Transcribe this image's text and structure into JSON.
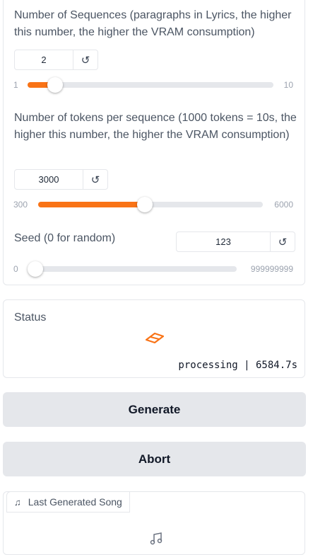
{
  "sequences": {
    "label": "Number of Sequences (paragraphs in Lyrics, the higher this number, the higher the VRAM consumption)",
    "value": "2",
    "min": "1",
    "max": "10",
    "level": 0.111,
    "reset_icon": "reset-icon"
  },
  "tokens": {
    "label": "Number of tokens per sequence (1000 tokens = 10s, the higher this number, the higher the VRAM consumption)",
    "value": "3000",
    "min": "300",
    "max": "6000",
    "level": 0.474,
    "reset_icon": "reset-icon"
  },
  "seed": {
    "label": "Seed (0 for random)",
    "value": "123",
    "min": "0",
    "max": "999999999",
    "level": 0.0,
    "reset_icon": "reset-icon"
  },
  "status": {
    "label": "Status",
    "text": "processing | 6584.7s",
    "icon": "loading-icon",
    "accent": "#f97316"
  },
  "buttons": {
    "generate": "Generate",
    "abort": "Abort"
  },
  "last_song": {
    "label": "Last Generated Song",
    "icon": "music-note-icon"
  },
  "colors": {
    "accent": "#f97316",
    "track": "#e5e7eb",
    "button_bg": "#e5e7eb"
  }
}
